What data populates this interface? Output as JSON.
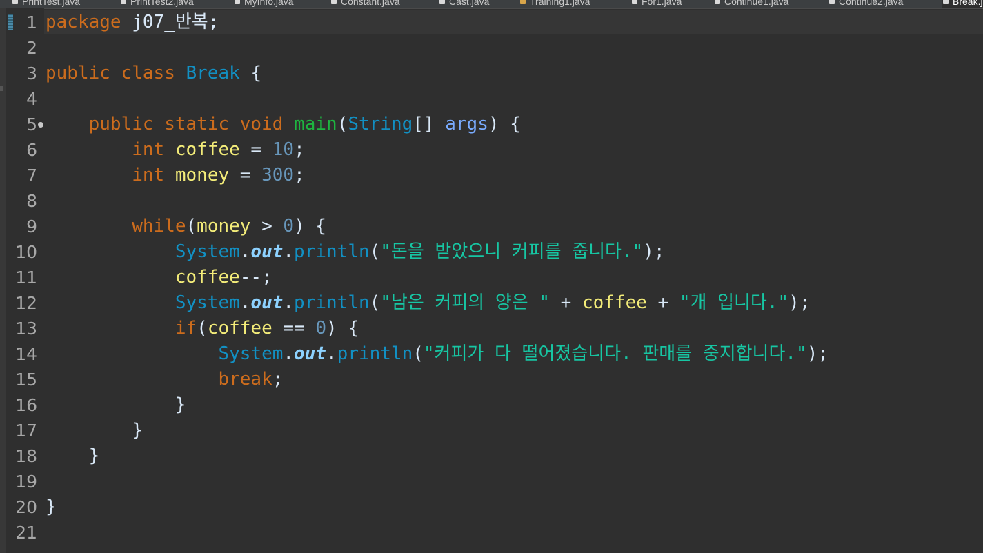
{
  "tabs": [
    {
      "label": "PrintTest.java",
      "icon": "java-file-icon",
      "warn": false
    },
    {
      "label": "PrintTest2.java",
      "icon": "java-file-icon",
      "warn": false
    },
    {
      "label": "MyInfo.java",
      "icon": "java-file-icon",
      "warn": false
    },
    {
      "label": "Constant.java",
      "icon": "java-file-icon",
      "warn": false
    },
    {
      "label": "Cast.java",
      "icon": "java-file-icon",
      "warn": false
    },
    {
      "label": "Training1.java",
      "icon": "java-file-warning-icon",
      "warn": true
    },
    {
      "label": "For1.java",
      "icon": "java-file-icon",
      "warn": false
    },
    {
      "label": "Continue1.java",
      "icon": "java-file-icon",
      "warn": false
    },
    {
      "label": "Continue2.java",
      "icon": "java-file-icon",
      "warn": false
    },
    {
      "label": "Break.java",
      "icon": "java-file-icon",
      "warn": false,
      "active": true
    }
  ],
  "editor": {
    "colors": {
      "background": "#2f2f2f",
      "keyword": "#cc6c1d",
      "type": "#1290c3",
      "string": "#17c6a3",
      "number": "#6897bb",
      "variable": "#f3ec79",
      "method": "#1eb540"
    },
    "lines": [
      {
        "no": "1",
        "tokens": [
          {
            "t": "package",
            "c": "keyword"
          },
          {
            "t": " j07_반복;",
            "c": "plain"
          }
        ]
      },
      {
        "no": "2",
        "tokens": []
      },
      {
        "no": "3",
        "tokens": [
          {
            "t": "public",
            "c": "keyword"
          },
          {
            "t": " ",
            "c": "plain"
          },
          {
            "t": "class",
            "c": "keyword"
          },
          {
            "t": " ",
            "c": "plain"
          },
          {
            "t": "Break",
            "c": "type"
          },
          {
            "t": " {",
            "c": "plain"
          }
        ]
      },
      {
        "no": "4",
        "tokens": []
      },
      {
        "no": "5",
        "fold": true,
        "tokens": [
          {
            "t": "    ",
            "c": "plain"
          },
          {
            "t": "public",
            "c": "keyword"
          },
          {
            "t": " ",
            "c": "plain"
          },
          {
            "t": "static",
            "c": "keyword"
          },
          {
            "t": " ",
            "c": "plain"
          },
          {
            "t": "void",
            "c": "keyword"
          },
          {
            "t": " ",
            "c": "plain"
          },
          {
            "t": "main",
            "c": "method"
          },
          {
            "t": "(",
            "c": "plain"
          },
          {
            "t": "String",
            "c": "type"
          },
          {
            "t": "[] ",
            "c": "plain"
          },
          {
            "t": "args",
            "c": "param"
          },
          {
            "t": ") {",
            "c": "plain"
          }
        ]
      },
      {
        "no": "6",
        "tokens": [
          {
            "t": "        ",
            "c": "plain"
          },
          {
            "t": "int",
            "c": "keyword"
          },
          {
            "t": " ",
            "c": "plain"
          },
          {
            "t": "coffee",
            "c": "local"
          },
          {
            "t": " = ",
            "c": "plain"
          },
          {
            "t": "10",
            "c": "number"
          },
          {
            "t": ";",
            "c": "plain"
          }
        ]
      },
      {
        "no": "7",
        "tokens": [
          {
            "t": "        ",
            "c": "plain"
          },
          {
            "t": "int",
            "c": "keyword"
          },
          {
            "t": " ",
            "c": "plain"
          },
          {
            "t": "money",
            "c": "local"
          },
          {
            "t": " = ",
            "c": "plain"
          },
          {
            "t": "300",
            "c": "number"
          },
          {
            "t": ";",
            "c": "plain"
          }
        ]
      },
      {
        "no": "8",
        "tokens": []
      },
      {
        "no": "9",
        "tokens": [
          {
            "t": "        ",
            "c": "plain"
          },
          {
            "t": "while",
            "c": "keyword"
          },
          {
            "t": "(",
            "c": "plain"
          },
          {
            "t": "money",
            "c": "local"
          },
          {
            "t": " > ",
            "c": "plain"
          },
          {
            "t": "0",
            "c": "number"
          },
          {
            "t": ") {",
            "c": "plain"
          }
        ]
      },
      {
        "no": "10",
        "tokens": [
          {
            "t": "            ",
            "c": "plain"
          },
          {
            "t": "System",
            "c": "type"
          },
          {
            "t": ".",
            "c": "plain"
          },
          {
            "t": "out",
            "c": "static"
          },
          {
            "t": ".",
            "c": "plain"
          },
          {
            "t": "println",
            "c": "type"
          },
          {
            "t": "(",
            "c": "plain"
          },
          {
            "t": "\"돈을 받았으니 커피를 줍니다.\"",
            "c": "string"
          },
          {
            "t": ");",
            "c": "plain"
          }
        ]
      },
      {
        "no": "11",
        "tokens": [
          {
            "t": "            ",
            "c": "plain"
          },
          {
            "t": "coffee",
            "c": "local"
          },
          {
            "t": "--;",
            "c": "plain"
          }
        ]
      },
      {
        "no": "12",
        "tokens": [
          {
            "t": "            ",
            "c": "plain"
          },
          {
            "t": "System",
            "c": "type"
          },
          {
            "t": ".",
            "c": "plain"
          },
          {
            "t": "out",
            "c": "static"
          },
          {
            "t": ".",
            "c": "plain"
          },
          {
            "t": "println",
            "c": "type"
          },
          {
            "t": "(",
            "c": "plain"
          },
          {
            "t": "\"남은 커피의 양은 \"",
            "c": "string"
          },
          {
            "t": " + ",
            "c": "plain"
          },
          {
            "t": "coffee",
            "c": "local"
          },
          {
            "t": " + ",
            "c": "plain"
          },
          {
            "t": "\"개 입니다.\"",
            "c": "string"
          },
          {
            "t": ");",
            "c": "plain"
          }
        ]
      },
      {
        "no": "13",
        "tokens": [
          {
            "t": "            ",
            "c": "plain"
          },
          {
            "t": "if",
            "c": "keyword"
          },
          {
            "t": "(",
            "c": "plain"
          },
          {
            "t": "coffee",
            "c": "local"
          },
          {
            "t": " == ",
            "c": "plain"
          },
          {
            "t": "0",
            "c": "number"
          },
          {
            "t": ") {",
            "c": "plain"
          }
        ]
      },
      {
        "no": "14",
        "tokens": [
          {
            "t": "                ",
            "c": "plain"
          },
          {
            "t": "System",
            "c": "type"
          },
          {
            "t": ".",
            "c": "plain"
          },
          {
            "t": "out",
            "c": "static"
          },
          {
            "t": ".",
            "c": "plain"
          },
          {
            "t": "println",
            "c": "type"
          },
          {
            "t": "(",
            "c": "plain"
          },
          {
            "t": "\"커피가 다 떨어졌습니다. 판매를 중지합니다.\"",
            "c": "string"
          },
          {
            "t": ");",
            "c": "plain"
          }
        ]
      },
      {
        "no": "15",
        "tokens": [
          {
            "t": "                ",
            "c": "plain"
          },
          {
            "t": "break",
            "c": "keyword"
          },
          {
            "t": ";",
            "c": "plain"
          }
        ]
      },
      {
        "no": "16",
        "tokens": [
          {
            "t": "            }",
            "c": "plain"
          }
        ]
      },
      {
        "no": "17",
        "tokens": [
          {
            "t": "        }",
            "c": "plain"
          }
        ]
      },
      {
        "no": "18",
        "tokens": [
          {
            "t": "    }",
            "c": "plain"
          }
        ]
      },
      {
        "no": "19",
        "tokens": []
      },
      {
        "no": "20",
        "tokens": [
          {
            "t": "}",
            "c": "plain"
          }
        ]
      },
      {
        "no": "21",
        "tokens": []
      }
    ]
  }
}
